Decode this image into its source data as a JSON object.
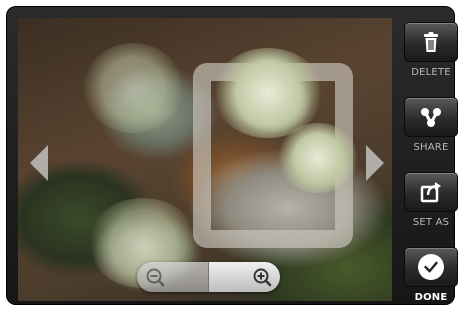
{
  "viewer": {
    "photo": {
      "subject": "succulent-plants-photo"
    },
    "nav": {
      "prev_icon": "chevron-left-icon",
      "next_icon": "chevron-right-icon"
    },
    "zoom": {
      "out_icon": "zoom-out-icon",
      "in_icon": "zoom-in-icon"
    }
  },
  "actions": [
    {
      "id": "delete",
      "label": "DELETE",
      "icon": "trash-icon"
    },
    {
      "id": "share",
      "label": "SHARE",
      "icon": "share-icon"
    },
    {
      "id": "set_as",
      "label": "SET AS",
      "icon": "set-as-icon"
    },
    {
      "id": "done",
      "label": "DONE",
      "icon": "checkmark-icon"
    }
  ],
  "colors": {
    "panel_bg": "#1f1f1f",
    "button_face": "#3a3a3a",
    "label": "#b8b8b8",
    "label_done": "#ffffff"
  }
}
